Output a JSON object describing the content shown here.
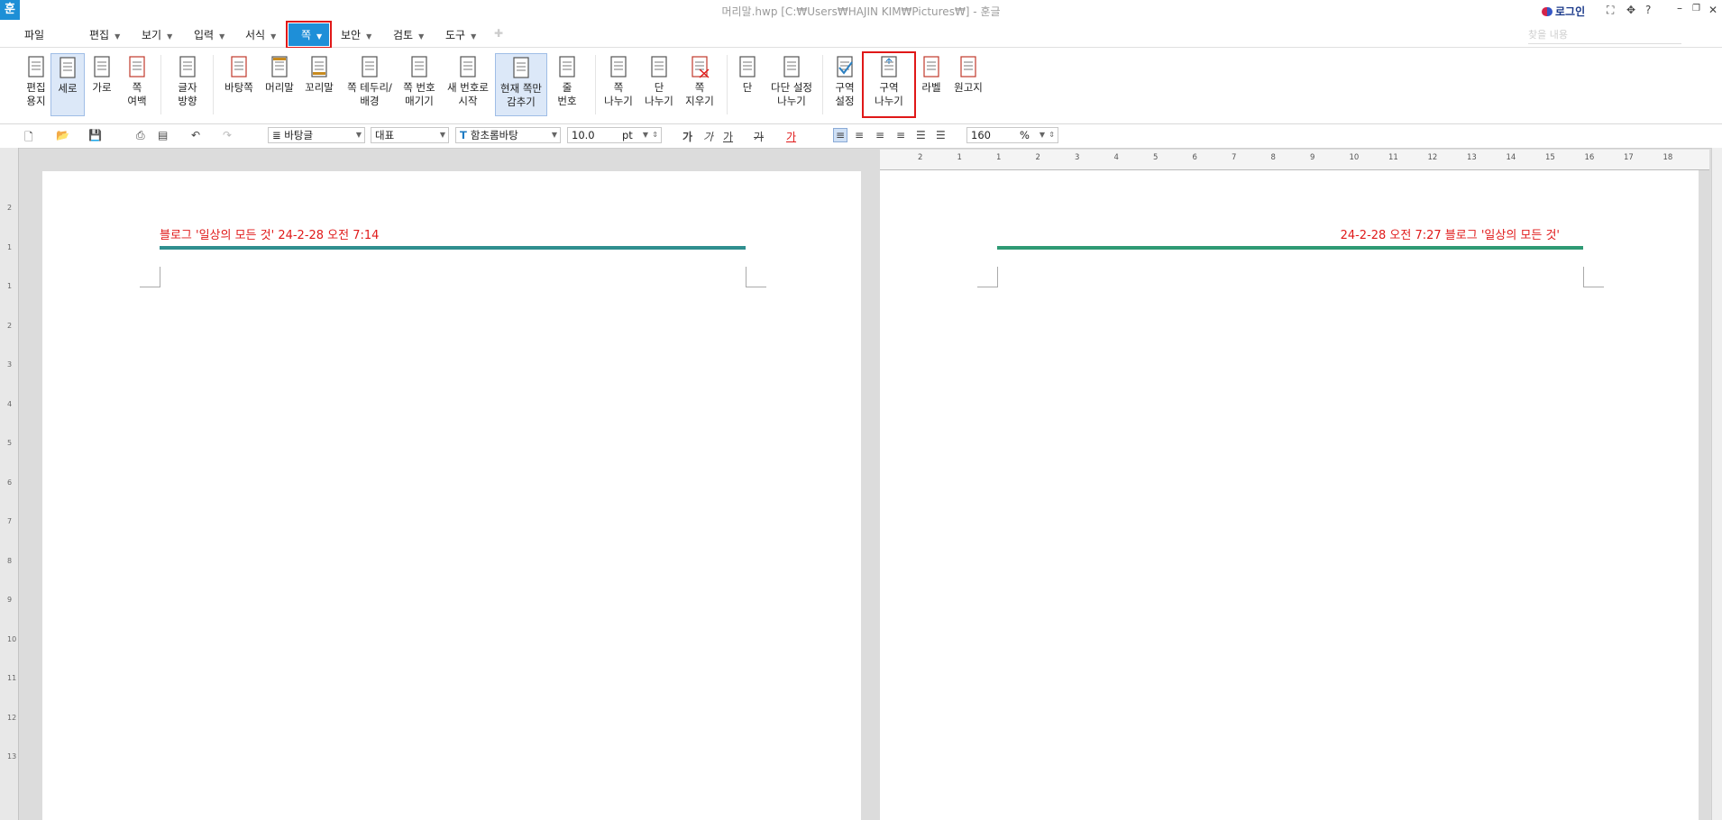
{
  "titlebar": {
    "logo": "훈",
    "title": "머리말.hwp [C:₩Users₩HAJIN KIM₩Pictures₩] - 훈글",
    "login_label": "로그인",
    "help": "?"
  },
  "menubar": {
    "file": "파일",
    "items": [
      "편집",
      "보기",
      "입력",
      "서식",
      "쪽",
      "보안",
      "검토",
      "도구"
    ],
    "active_index": 4,
    "search_placeholder": "찾을 내용"
  },
  "ribbon": {
    "buttons": [
      {
        "l1": "편집",
        "l2": "용지",
        "icon": "page-setup-icon"
      },
      {
        "l1": "세로",
        "l2": "",
        "icon": "portrait-icon",
        "selected": true
      },
      {
        "l1": "가로",
        "l2": "",
        "icon": "landscape-icon"
      },
      {
        "l1": "쪽",
        "l2": "여백",
        "icon": "page-margin-icon"
      },
      {
        "l1": "글자",
        "l2": "방향",
        "icon": "text-direction-icon"
      },
      {
        "l1": "바탕쪽",
        "l2": "",
        "icon": "master-page-icon"
      },
      {
        "l1": "머리말",
        "l2": "",
        "icon": "header-icon"
      },
      {
        "l1": "꼬리말",
        "l2": "",
        "icon": "footer-icon"
      },
      {
        "l1": "쪽 테두리/",
        "l2": "배경",
        "icon": "page-border-icon"
      },
      {
        "l1": "쪽 번호",
        "l2": "매기기",
        "icon": "page-number-icon"
      },
      {
        "l1": "새 번호로",
        "l2": "시작",
        "icon": "new-number-icon"
      },
      {
        "l1": "현재 쪽만",
        "l2": "감추기",
        "icon": "hide-page-icon",
        "selected": true
      },
      {
        "l1": "줄",
        "l2": "번호",
        "icon": "line-number-icon"
      },
      {
        "l1": "쪽",
        "l2": "나누기",
        "icon": "page-break-icon"
      },
      {
        "l1": "단",
        "l2": "나누기",
        "icon": "column-break-icon"
      },
      {
        "l1": "쪽",
        "l2": "지우기",
        "icon": "delete-page-icon"
      },
      {
        "l1": "단",
        "l2": "",
        "icon": "columns-icon"
      },
      {
        "l1": "다단 설정",
        "l2": "나누기",
        "icon": "multi-column-icon"
      },
      {
        "l1": "구역",
        "l2": "설정",
        "icon": "section-setup-icon"
      },
      {
        "l1": "구역",
        "l2": "나누기",
        "icon": "section-break-icon",
        "highlighted": true
      },
      {
        "l1": "라벨",
        "l2": "",
        "icon": "label-icon"
      },
      {
        "l1": "원고지",
        "l2": "",
        "icon": "manuscript-icon"
      }
    ]
  },
  "format_bar": {
    "style": "바탕글",
    "language": "대표",
    "font": "함초롬바탕",
    "font_size": "10.0",
    "size_unit": "pt",
    "bold": "가",
    "italic": "가",
    "underline": "가",
    "strike": "가",
    "color_char": "가",
    "zoom": "160",
    "zoom_unit": "%"
  },
  "rulers": {
    "horizontal": [
      "2",
      "1",
      "1",
      "2",
      "3",
      "4",
      "5",
      "6",
      "7",
      "8",
      "9",
      "10",
      "11",
      "12",
      "13",
      "14",
      "15",
      "16",
      "17",
      "18"
    ],
    "vertical": [
      "2",
      "1",
      "1",
      "2",
      "3",
      "4",
      "5",
      "6",
      "7",
      "8",
      "9",
      "10",
      "11",
      "12",
      "13"
    ]
  },
  "pages": [
    {
      "header_text": "블로그 '일상의 모든 것' 24-2-28 오전 7:14",
      "align": "left",
      "line_color": "#2f8f8f"
    },
    {
      "header_text": "24-2-28 오전 7:27 블로그 '일상의 모든 것'",
      "align": "right",
      "line_color": "#2e9a74"
    }
  ]
}
